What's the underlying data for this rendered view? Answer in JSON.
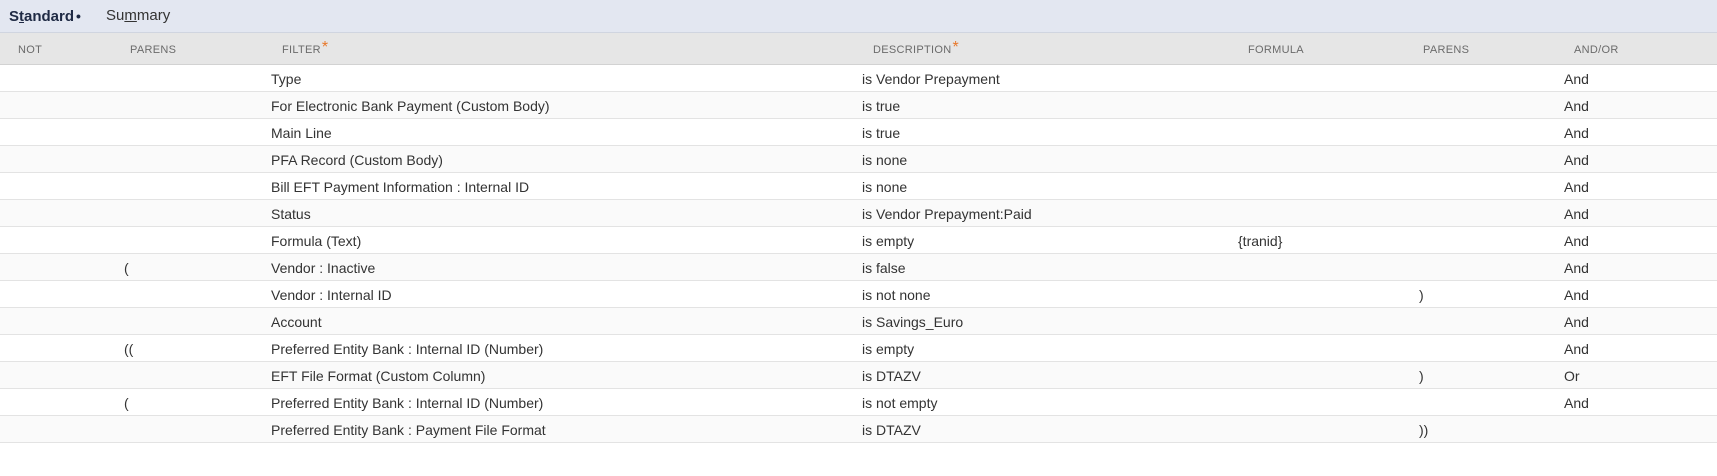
{
  "tabs": [
    {
      "label_pre": "S",
      "label_ul": "t",
      "label_post": "andard",
      "marker": "•"
    },
    {
      "label_pre": "Su",
      "label_ul": "m",
      "label_post": "mary"
    }
  ],
  "columns": {
    "not": "NOT",
    "parens": "PARENS",
    "filter": "FILTER",
    "description": "DESCRIPTION",
    "formula": "FORMULA",
    "parens_close": "PARENS",
    "andor": "AND/OR",
    "required_marker": "*"
  },
  "rows": [
    {
      "not": "",
      "parens": "",
      "filter": "Type",
      "description": "is Vendor Prepayment",
      "formula": "",
      "parens_close": "",
      "andor": "And"
    },
    {
      "not": "",
      "parens": "",
      "filter": "For Electronic Bank Payment (Custom Body)",
      "description": "is true",
      "formula": "",
      "parens_close": "",
      "andor": "And"
    },
    {
      "not": "",
      "parens": "",
      "filter": "Main Line",
      "description": "is true",
      "formula": "",
      "parens_close": "",
      "andor": "And"
    },
    {
      "not": "",
      "parens": "",
      "filter": "PFA Record (Custom Body)",
      "description": "is none",
      "formula": "",
      "parens_close": "",
      "andor": "And"
    },
    {
      "not": "",
      "parens": "",
      "filter": "Bill EFT Payment Information : Internal ID",
      "description": "is none",
      "formula": "",
      "parens_close": "",
      "andor": "And"
    },
    {
      "not": "",
      "parens": "",
      "filter": "Status",
      "description": "is Vendor Prepayment:Paid",
      "formula": "",
      "parens_close": "",
      "andor": "And"
    },
    {
      "not": "",
      "parens": "",
      "filter": "Formula (Text)",
      "description": "is empty",
      "formula": "{tranid}",
      "parens_close": "",
      "andor": "And"
    },
    {
      "not": "",
      "parens": "(",
      "filter": "Vendor : Inactive",
      "description": "is false",
      "formula": "",
      "parens_close": "",
      "andor": "And"
    },
    {
      "not": "",
      "parens": "",
      "filter": "Vendor : Internal ID",
      "description": "is not none",
      "formula": "",
      "parens_close": ")",
      "andor": "And"
    },
    {
      "not": "",
      "parens": "",
      "filter": "Account",
      "description": "is Savings_Euro",
      "formula": "",
      "parens_close": "",
      "andor": "And"
    },
    {
      "not": "",
      "parens": "((",
      "filter": "Preferred Entity Bank : Internal ID (Number)",
      "description": "is empty",
      "formula": "",
      "parens_close": "",
      "andor": "And"
    },
    {
      "not": "",
      "parens": "",
      "filter": "EFT File Format (Custom Column)",
      "description": "is DTAZV",
      "formula": "",
      "parens_close": ")",
      "andor": "Or"
    },
    {
      "not": "",
      "parens": "(",
      "filter": "Preferred Entity Bank : Internal ID (Number)",
      "description": "is not empty",
      "formula": "",
      "parens_close": "",
      "andor": "And"
    },
    {
      "not": "",
      "parens": "",
      "filter": "Preferred Entity Bank : Payment File Format",
      "description": "is DTAZV",
      "formula": "",
      "parens_close": "))",
      "andor": ""
    }
  ]
}
